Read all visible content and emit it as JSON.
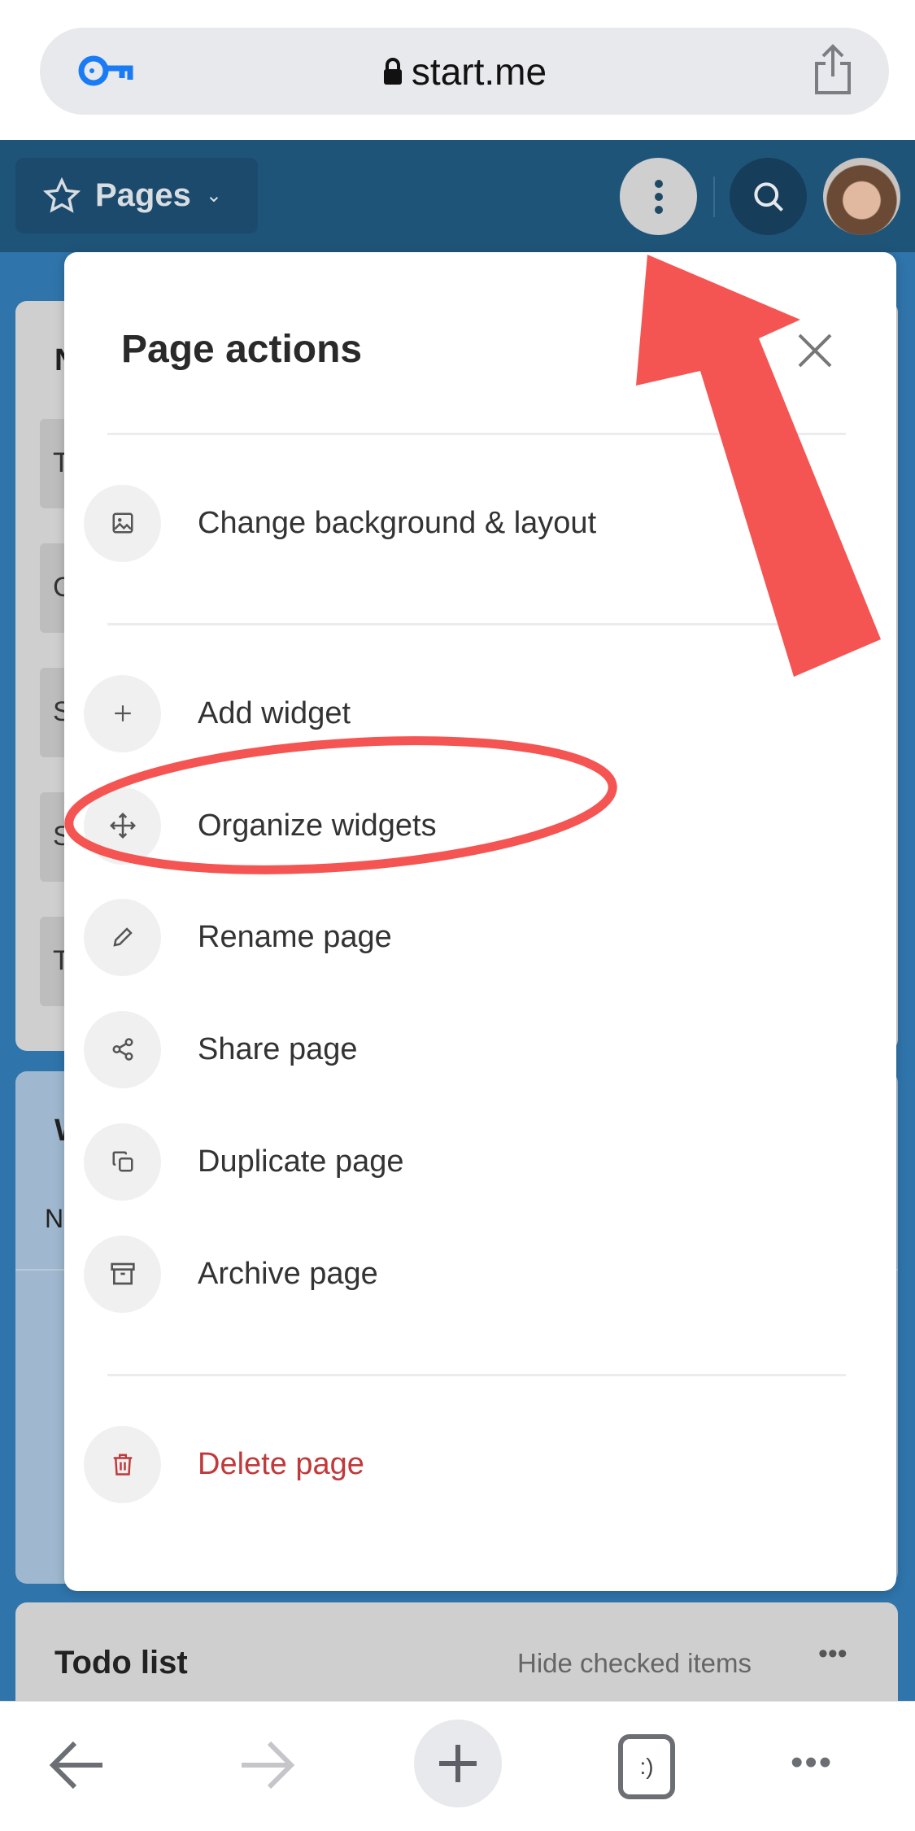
{
  "browser": {
    "url": "start.me",
    "back_label": "back",
    "forward_label": "forward"
  },
  "header": {
    "pages_label": "Pages"
  },
  "background": {
    "card1_title": "N",
    "card1_rows": [
      "T",
      "C",
      "S",
      "S",
      "T"
    ],
    "card2_title": "W",
    "card2_sub": "N",
    "todo_title": "Todo list",
    "todo_hide": "Hide checked items"
  },
  "modal": {
    "title": "Page actions",
    "items": [
      {
        "label": "Change background & layout",
        "icon": "image-icon"
      },
      {
        "label": "Add widget",
        "icon": "plus-icon"
      },
      {
        "label": "Organize widgets",
        "icon": "move-icon"
      },
      {
        "label": "Rename page",
        "icon": "pencil-icon"
      },
      {
        "label": "Share page",
        "icon": "share-icon"
      },
      {
        "label": "Duplicate page",
        "icon": "copy-icon"
      },
      {
        "label": "Archive page",
        "icon": "archive-icon"
      },
      {
        "label": "Delete page",
        "icon": "trash-icon"
      }
    ]
  },
  "colors": {
    "header": "#1f5479",
    "background": "#2f74ab",
    "delete": "#c0393b",
    "annotation": "#f55552"
  }
}
